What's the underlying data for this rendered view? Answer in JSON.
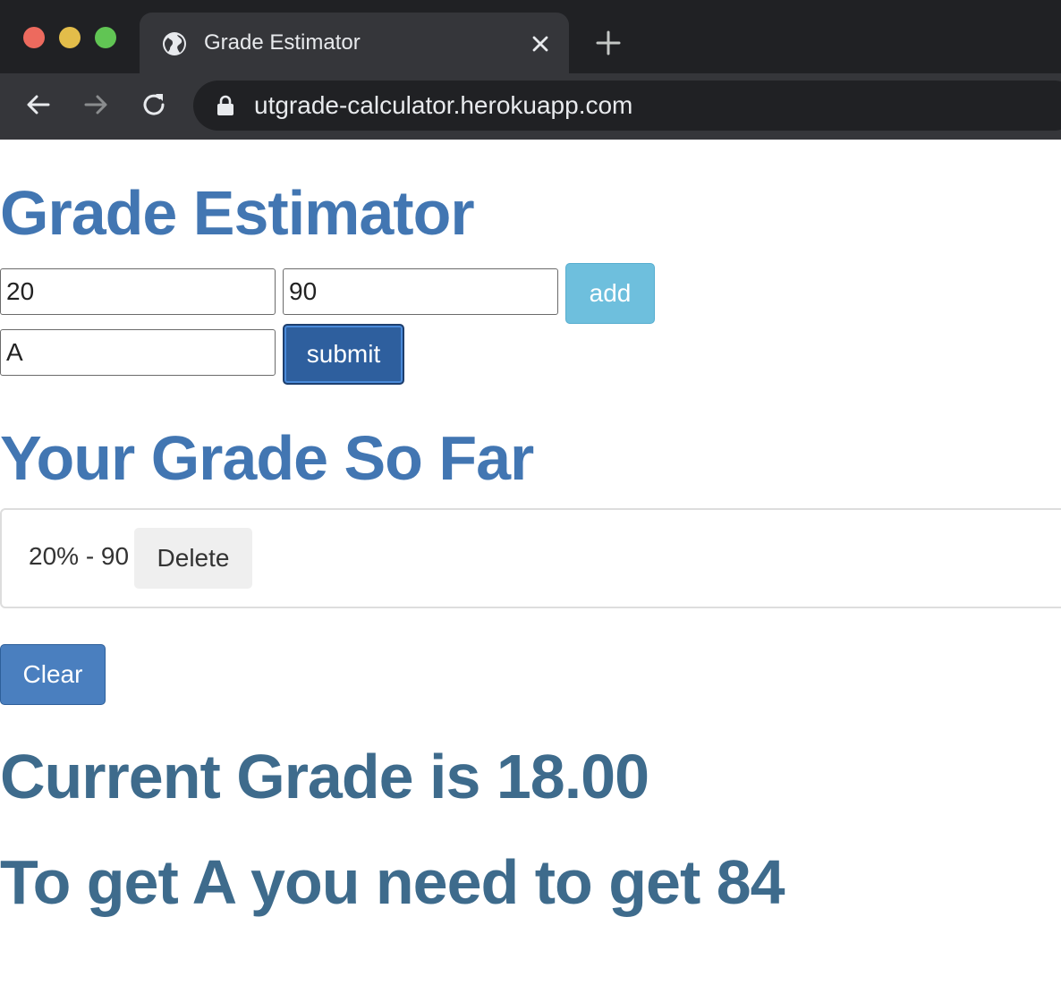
{
  "browser": {
    "tab_title": "Grade Estimator",
    "url": "utgrade-calculator.herokuapp.com",
    "icons": {
      "tab": "globe-icon",
      "close": "close-icon",
      "new_tab": "plus-icon",
      "back": "back-arrow-icon",
      "forward": "forward-arrow-icon",
      "reload": "reload-icon",
      "secure": "lock-icon"
    }
  },
  "page": {
    "title": "Grade Estimator",
    "form": {
      "weight_value": "20",
      "grade_value": "90",
      "target_value": "A",
      "add_label": "add",
      "submit_label": "submit"
    },
    "list": {
      "heading": "Your Grade So Far",
      "items": [
        {
          "text": "20% - 90",
          "delete_label": "Delete"
        }
      ]
    },
    "clear_label": "Clear",
    "results": {
      "current": "Current Grade is 18.00",
      "needed": "To get A you need to get 84"
    }
  },
  "colors": {
    "heading": "#4276b2",
    "result": "#3e6b8c",
    "add_button": "#6ebfdd",
    "submit_button": "#2e5f9e",
    "clear_button": "#4a7fbf"
  }
}
